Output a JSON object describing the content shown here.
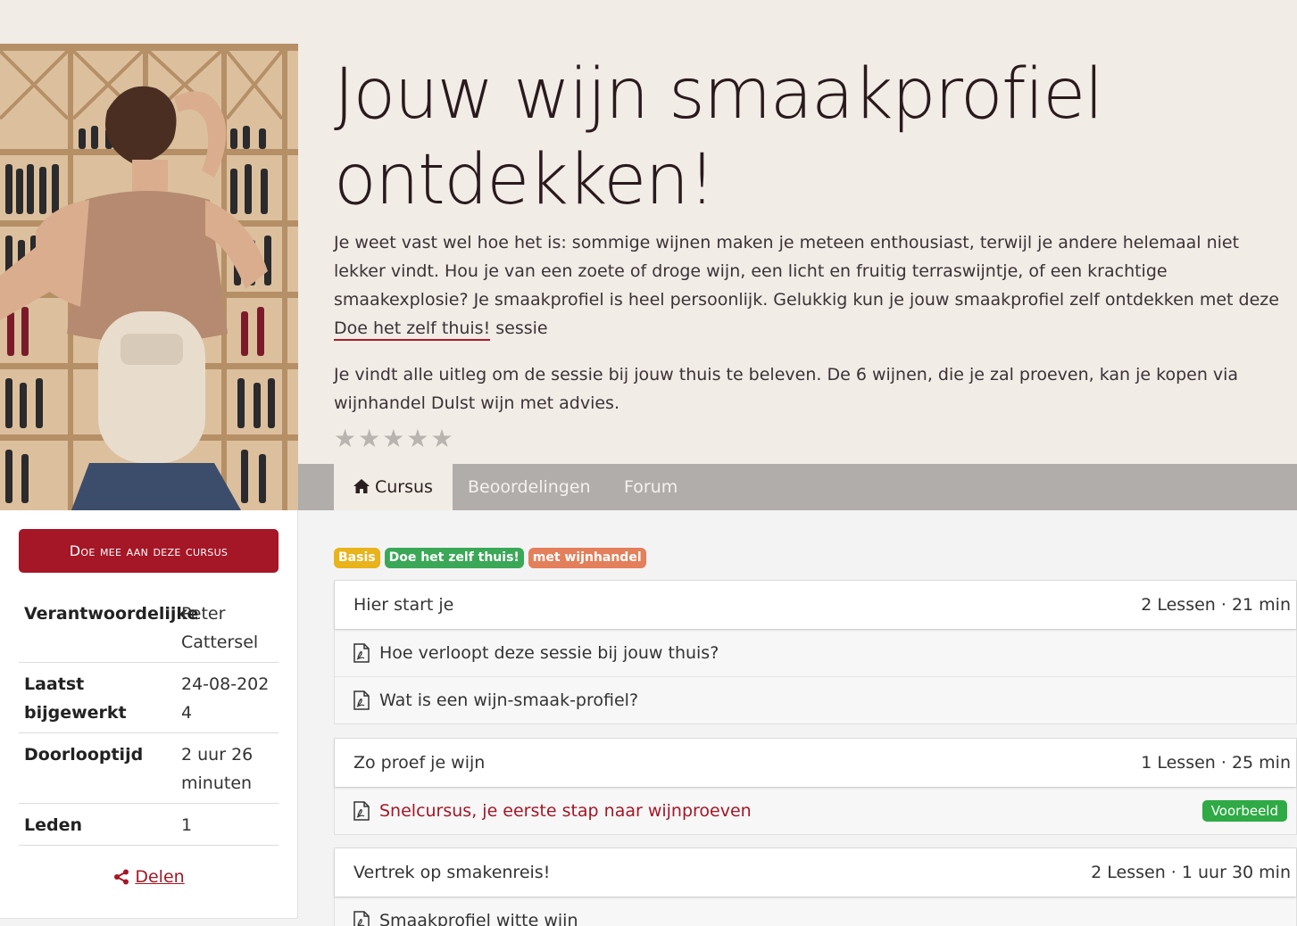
{
  "course": {
    "title": "Jouw wijn smaakprofiel ontdekken!",
    "intro_p1_a": "Je weet vast wel hoe het is: sommige wijnen maken je meteen enthousiast, terwijl je andere helemaal niet lekker vindt. Hou je van een zoete of droge wijn, een licht en fruitig terraswijntje, of een krachtige smaakexplosie? Je smaakprofiel is heel persoonlijk.  Gelukkig kun je jouw smaakprofiel zelf ontdekken met deze ",
    "intro_p1_link": "Doe het zelf thuis!",
    "intro_p1_b": " sessie",
    "intro_p2": "Je vindt alle uitleg om de sessie bij jouw thuis te beleven. De 6 wijnen, die je zal proeven, kan je kopen via wijnhandel Dulst wijn met advies.",
    "rating": 0,
    "star_glyph": "★"
  },
  "tabs": [
    {
      "label": "Cursus",
      "icon": "home-icon",
      "active": true
    },
    {
      "label": "Beoordelingen",
      "active": false
    },
    {
      "label": "Forum",
      "active": false
    }
  ],
  "sidebar": {
    "join_label": "Doe mee aan deze cursus",
    "meta": [
      {
        "key": "Verantwoordelijke",
        "value": "Peter Cattersel"
      },
      {
        "key": "Laatst bijgewerkt",
        "value": "24-08-2024"
      },
      {
        "key": "Doorlooptijd",
        "value": "2 uur 26 minuten"
      },
      {
        "key": "Leden",
        "value": "1"
      }
    ],
    "share_label": "Delen"
  },
  "badges": [
    {
      "label": "Basis",
      "color": "#e8b31b"
    },
    {
      "label": "Doe het zelf thuis!",
      "color": "#3aa856"
    },
    {
      "label": "met wijnhandel",
      "color": "#e37f5a"
    }
  ],
  "sections": [
    {
      "title": "Hier start je",
      "meta": "2 Lessen · 21 min",
      "lessons": [
        {
          "label": "Hoe verloopt deze sessie bij jouw thuis?"
        },
        {
          "label": "Wat is een wijn-smaak-profiel?"
        }
      ]
    },
    {
      "title": "Zo proef je wijn",
      "meta": "1 Lessen · 25 min",
      "lessons": [
        {
          "label": "Snelcursus, je eerste stap naar wijnproeven",
          "preview": "Voorbeeld"
        }
      ]
    },
    {
      "title": "Vertrek op smakenreis!",
      "meta": "2 Lessen · 1 uur 30 min",
      "lessons": [
        {
          "label": "Smaakprofiel witte wijn"
        }
      ]
    }
  ],
  "colors": {
    "accent": "#a51626",
    "preview_green": "#2faa45"
  }
}
